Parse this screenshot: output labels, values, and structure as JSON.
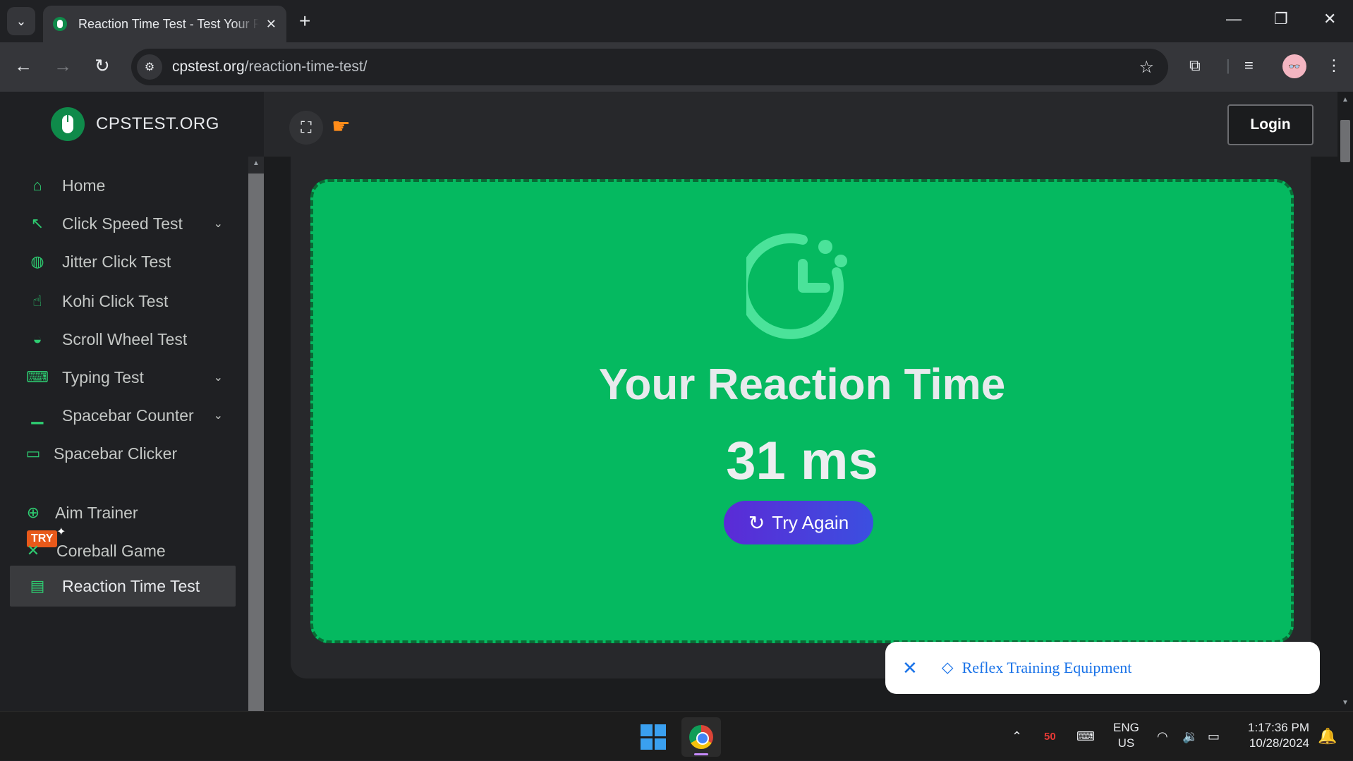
{
  "browser": {
    "tab_title": "Reaction Time Test - Test Your R",
    "url_host": "cpstest.org",
    "url_path": "/reaction-time-test/"
  },
  "site": {
    "brand": "CPSTEST.ORG",
    "login_label": "Login"
  },
  "sidebar": {
    "items": [
      {
        "label": "Home",
        "icon": "home-icon"
      },
      {
        "label": "Click Speed Test",
        "icon": "cursor-click-icon",
        "has_children": true
      },
      {
        "label": "Jitter Click Test",
        "icon": "jitter-mouse-icon"
      },
      {
        "label": "Kohi Click Test",
        "icon": "hand-pointer-icon"
      },
      {
        "label": "Scroll Wheel Test",
        "icon": "mouse-icon"
      },
      {
        "label": "Typing Test",
        "icon": "keyboard-icon",
        "has_children": true
      },
      {
        "label": "Spacebar Counter",
        "icon": "spacebar-icon",
        "has_children": true
      },
      {
        "label": "Spacebar Clicker",
        "icon": "spacebar-key-icon",
        "badge": "TRY"
      },
      {
        "label": "Aim Trainer",
        "icon": "crosshair-icon"
      },
      {
        "label": "Coreball Game",
        "icon": "coreball-icon"
      },
      {
        "label": "Reaction Time Test",
        "icon": "document-icon",
        "active": true
      }
    ]
  },
  "result": {
    "title": "Your Reaction Time",
    "value": "31 ms",
    "button_label": "Try Again"
  },
  "ad": {
    "label": "Reflex Training Equipment"
  },
  "taskbar": {
    "tray_count": "50",
    "lang_line1": "ENG",
    "lang_line2": "US",
    "time": "1:17:36 PM",
    "date": "10/28/2024"
  },
  "colors": {
    "game_bg": "#05b960",
    "accent_green": "#2ecc71",
    "button_gradient_start": "#5b2bd6",
    "button_gradient_end": "#3b4fe0"
  }
}
